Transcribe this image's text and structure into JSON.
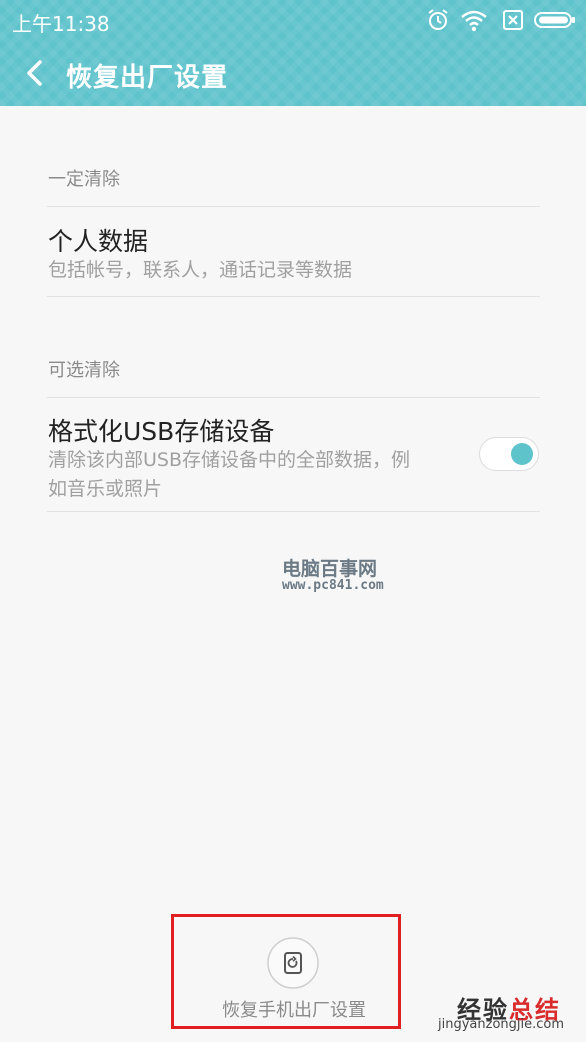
{
  "status_bar": {
    "time": "上午11:38",
    "icons": [
      "alarm-icon",
      "wifi-icon",
      "no-sim-icon",
      "battery-icon"
    ]
  },
  "header": {
    "back_icon": "chevron-left-icon",
    "title": "恢复出厂设置"
  },
  "sections": [
    {
      "title": "一定清除",
      "item": {
        "title": "个人数据",
        "subtitle": "包括帐号，联系人，通话记录等数据"
      }
    },
    {
      "title": "可选清除",
      "item": {
        "title": "格式化USB存储设备",
        "subtitle_line1": "清除该内部USB存储设备中的全部数据，例",
        "subtitle_line2": "如音乐或照片",
        "toggle_on": true
      }
    }
  ],
  "watermark": {
    "name": "电脑百事网",
    "url": "www.pc841.com"
  },
  "reset_button": {
    "icon": "phone-reset-icon",
    "label": "恢复手机出厂设置"
  },
  "brand": {
    "part1": "经验",
    "part2": "总结",
    "pinyin": "jingyanzongjie.com"
  },
  "colors": {
    "accent": "#5fc3cc",
    "highlight_border": "#e02020"
  }
}
